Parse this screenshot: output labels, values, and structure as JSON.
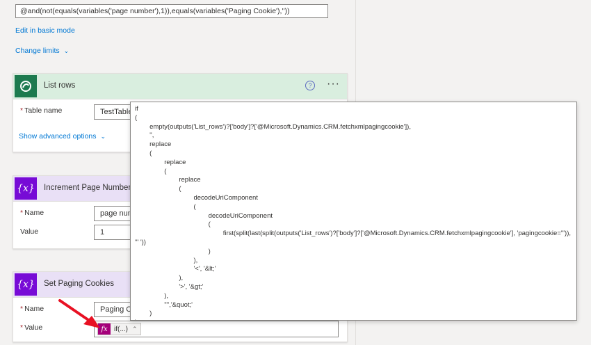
{
  "condition": {
    "expression": "@and(not(equals(variables('page number'),1)),equals(variables('Paging Cookie'),''))",
    "edit_basic_mode": "Edit in basic mode",
    "change_limits": "Change limits"
  },
  "list_rows": {
    "title": "List rows",
    "table_name_label": "Table name",
    "table_name_value": "TestTable",
    "show_advanced": "Show advanced options"
  },
  "increment": {
    "title": "Increment Page Number",
    "name_label": "Name",
    "name_value": "page num",
    "value_label": "Value",
    "value_value": "1"
  },
  "set_paging": {
    "title": "Set Paging Cookies",
    "name_label": "Name",
    "name_value": "Paging Co",
    "value_label": "Value",
    "token_label": "if(...)"
  },
  "expression_popup": {
    "lines": [
      "if",
      "(",
      "        empty(outputs('List_rows')?['body']?['@Microsoft.Dynamics.CRM.fetchxmlpagingcookie']),",
      "        '',",
      "        replace",
      "        (",
      "                replace",
      "                (",
      "                        replace",
      "                        (",
      "                                decodeUriComponent",
      "                                (",
      "                                        decodeUriComponent",
      "                                        (",
      "                                                first(split(last(split(outputs('List_rows')?['body']?['@Microsoft.Dynamics.CRM.fetchxmlpagingcookie'], 'pagingcookie=\"')),",
      "'\" '))",
      "                                        )",
      "                                ),",
      "                                '<', '&lt;'",
      "                        ),",
      "                        '>', '&gt;'",
      "                ),",
      "                '\"','&quot;'",
      "        )",
      ")"
    ]
  },
  "icons": {
    "dataverse": "dataverse-icon",
    "variable": "{x}",
    "fx": "fx"
  },
  "colors": {
    "accent": "#0078d4",
    "dataverse_green": "#1d7a4f",
    "variable_purple": "#770bd6",
    "fx_magenta": "#a5007a",
    "arrow_red": "#e81123"
  }
}
